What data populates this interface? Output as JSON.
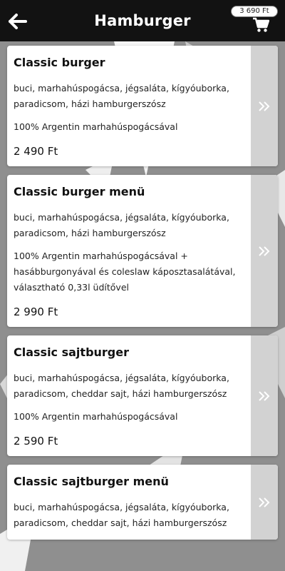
{
  "header": {
    "title": "Hamburger",
    "cart_total": "3 690 Ft",
    "back_icon": "arrow-left-icon",
    "cart_icon": "shopping-cart-icon"
  },
  "colors": {
    "topbar": "#121212",
    "background": "#8f8f8f",
    "card": "#ffffff",
    "arrow_panel": "#d2d2d2"
  },
  "products": [
    {
      "name": "Classic burger",
      "description": "buci, marhahúspogácsa, jégsaláta, kígyóuborka, paradicsom, házi hamburgerszósz",
      "note": "100% Argentin marhahúspogácsával",
      "price": "2 490 Ft",
      "arrow_icon": "double-chevron-right-icon"
    },
    {
      "name": "Classic burger menü",
      "description": "buci, marhahúspogácsa, jégsaláta, kígyóuborka, paradicsom, házi hamburgerszósz",
      "note": "100% Argentin marhahúspogácsával + hasábburgonyával és coleslaw káposztasalátával, választható 0,33l üdítővel",
      "price": "2 990 Ft",
      "arrow_icon": "double-chevron-right-icon"
    },
    {
      "name": "Classic sajtburger",
      "description": "buci, marhahúspogácsa, jégsaláta, kígyóuborka, paradicsom, cheddar sajt, házi hamburgerszósz",
      "note": "100% Argentin marhahúspogácsával",
      "price": "2 590 Ft",
      "arrow_icon": "double-chevron-right-icon"
    },
    {
      "name": "Classic sajtburger menü",
      "description": "buci, marhahúspogácsa, jégsaláta, kígyóuborka, paradicsom, cheddar sajt, házi hamburgerszósz",
      "note": "",
      "price": "",
      "arrow_icon": "double-chevron-right-icon"
    }
  ]
}
